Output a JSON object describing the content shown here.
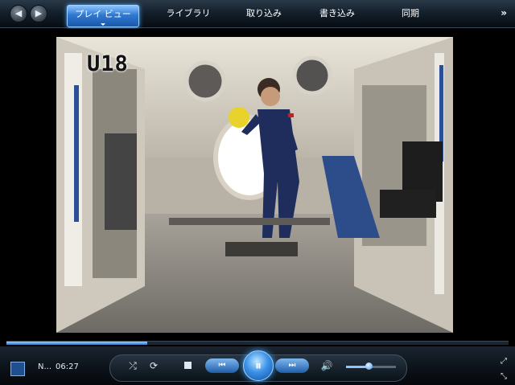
{
  "window": {
    "tabs": [
      {
        "label": "プレイ ビュー",
        "active": true
      },
      {
        "label": "ライブラリ"
      },
      {
        "label": "取り込み"
      },
      {
        "label": "書き込み"
      },
      {
        "label": "同期"
      }
    ],
    "more_label": "»"
  },
  "video": {
    "overlay_text": "U18"
  },
  "player": {
    "now_playing_title": "N...",
    "time": "06:27",
    "seek_progress": 0.28,
    "volume": 0.45
  },
  "controls": {
    "prev_glyph": "⏮",
    "play_glyph": "⏸",
    "next_glyph": "⏭"
  },
  "colors": {
    "accent": "#2f79d1",
    "bar": "#0d141b"
  }
}
